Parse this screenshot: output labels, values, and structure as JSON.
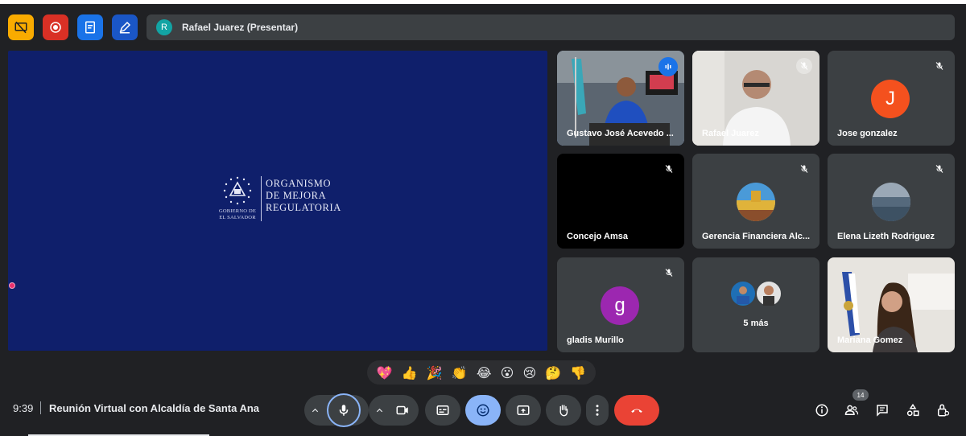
{
  "presenter": {
    "initial": "R",
    "label": "Rafael Juarez (Presentar)"
  },
  "stage": {
    "org_lines": [
      "ORGANISMO",
      "DE MEJORA",
      "REGULATORIA"
    ],
    "gov_lines": [
      "GOBIERNO DE",
      "EL SALVADOR"
    ]
  },
  "participants": [
    {
      "name": "Gustavo José Acevedo ...",
      "type": "video",
      "speaking": true
    },
    {
      "name": "Rafael Juarez",
      "type": "video",
      "muted": true
    },
    {
      "name": "Jose gonzalez",
      "initial": "J",
      "avatar_color": "#f4511e",
      "muted": true
    },
    {
      "name": "Concejo Amsa",
      "type": "black",
      "muted": true
    },
    {
      "name": "Gerencia Financiera Alc...",
      "type": "photo",
      "muted": true
    },
    {
      "name": "Elena Lizeth Rodriguez",
      "type": "photo",
      "muted": true
    },
    {
      "name": "gladis Murillo",
      "initial": "g",
      "avatar_color": "#9c27b0",
      "muted": true
    },
    {
      "name": "5 más",
      "type": "more"
    },
    {
      "name": "Mariana Gomez",
      "type": "video"
    }
  ],
  "reactions": [
    "💖",
    "👍",
    "🎉",
    "👏",
    "😂",
    "😮",
    "😢",
    "🤔",
    "👎"
  ],
  "meeting": {
    "time": "9:39",
    "title": "Reunión Virtual con Alcaldía de Santa Ana"
  },
  "people_count": "14",
  "colors": {
    "accent": "#8ab4f8",
    "hangup": "#ea4335",
    "stage_bg": "#0f1f6b",
    "tile_bg": "#3c4043"
  }
}
